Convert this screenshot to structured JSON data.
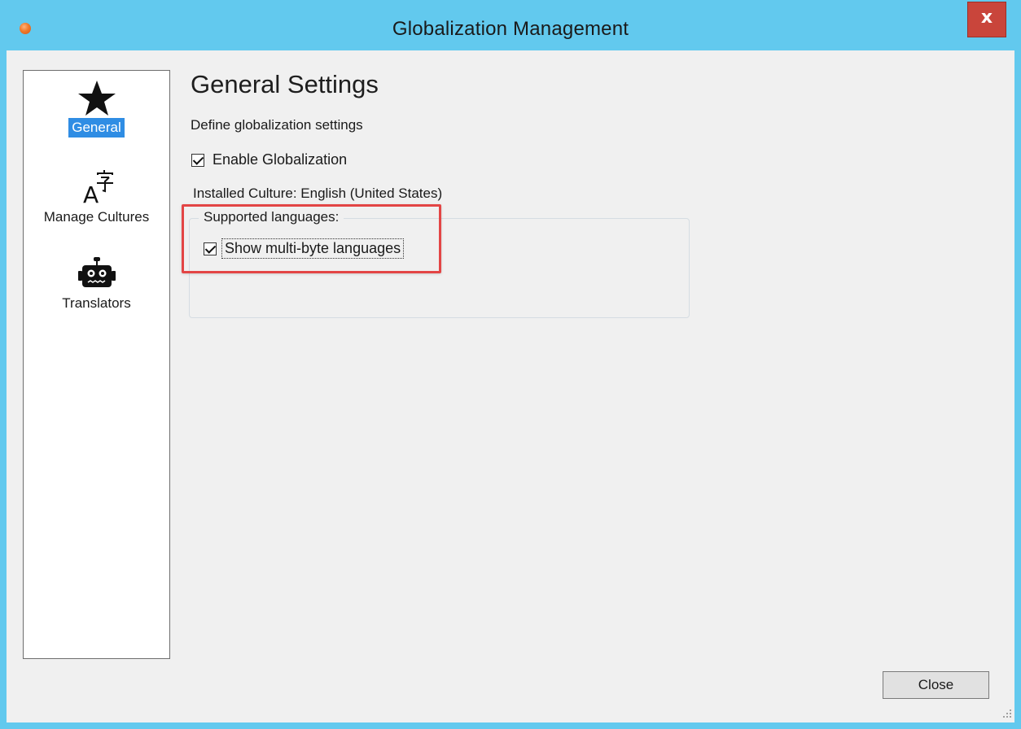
{
  "window": {
    "title": "Globalization Management",
    "close_glyph": "x"
  },
  "sidebar": {
    "items": [
      {
        "label": "General",
        "icon": "star-icon",
        "selected": true
      },
      {
        "label": "Manage Cultures",
        "icon": "language-icon"
      },
      {
        "label": "Translators",
        "icon": "robot-icon"
      }
    ]
  },
  "main": {
    "heading": "General Settings",
    "subheading": "Define globalization settings",
    "enable_globalization": {
      "label": "Enable Globalization",
      "checked": true
    },
    "installed_culture": "Installed Culture: English (United States)",
    "supported_languages": {
      "legend": "Supported languages:",
      "show_multibyte": {
        "label": "Show multi-byte languages",
        "checked": true
      }
    }
  },
  "footer": {
    "close_label": "Close"
  },
  "colors": {
    "titlebar": "#62c9ee",
    "selection": "#2f8de4",
    "highlight": "#e34545",
    "close_x": "#c9453b"
  }
}
